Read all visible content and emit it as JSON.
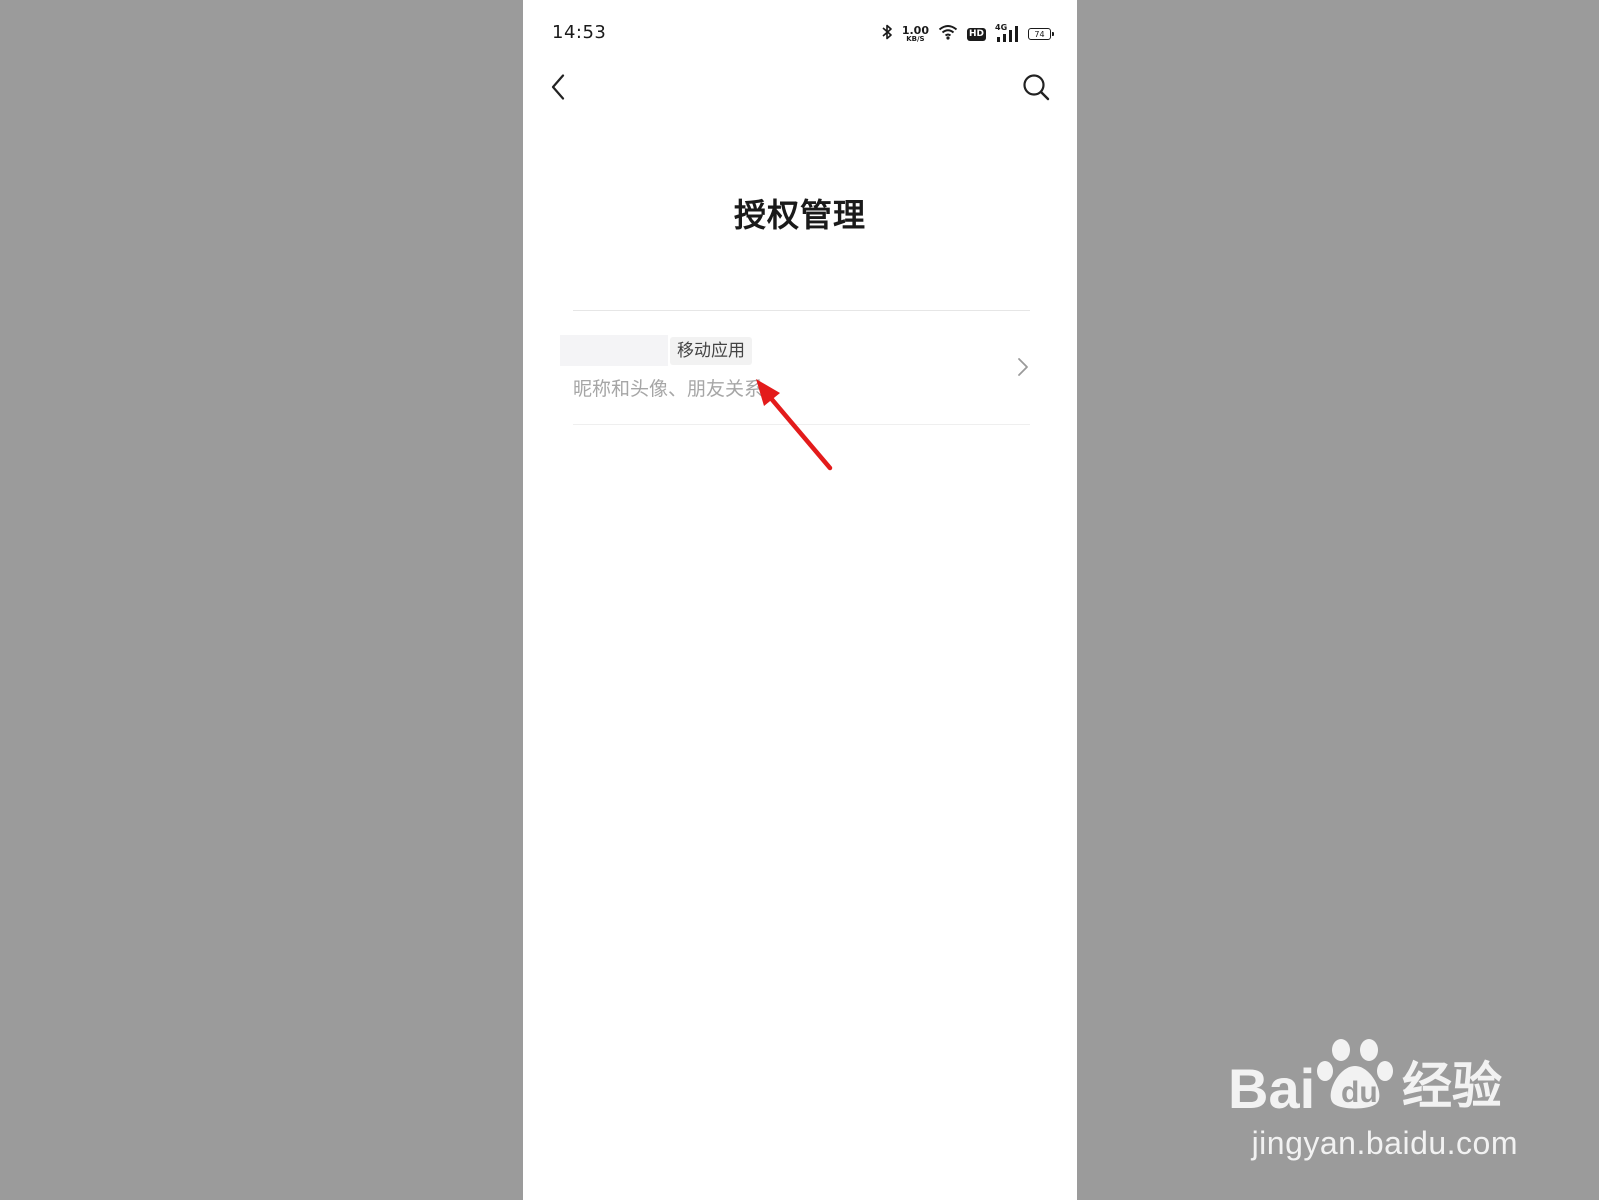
{
  "status_bar": {
    "time": "14:53",
    "net_speed_value": "1.00",
    "net_speed_unit": "KB/S",
    "hd_label": "HD",
    "network_type": "4G",
    "battery_level": "74",
    "icons": [
      "bluetooth-icon",
      "wifi-icon",
      "hd-icon",
      "signal-icon",
      "battery-icon"
    ]
  },
  "nav": {
    "back_icon": "back-chevron-icon",
    "search_icon": "search-icon"
  },
  "page": {
    "title": "授权管理"
  },
  "authorizations": [
    {
      "app_tag": "移动应用",
      "permissions": "昵称和头像、朋友关系"
    }
  ],
  "annotation": {
    "arrow_color": "#e31b1b"
  },
  "watermark": {
    "logo_text": "Bai 经验",
    "url": "jingyan.baidu.com"
  },
  "colors": {
    "background": "#9b9b9b",
    "screen": "#ffffff",
    "title_text": "#1a1a1a",
    "secondary_text": "#a6a6a6"
  }
}
